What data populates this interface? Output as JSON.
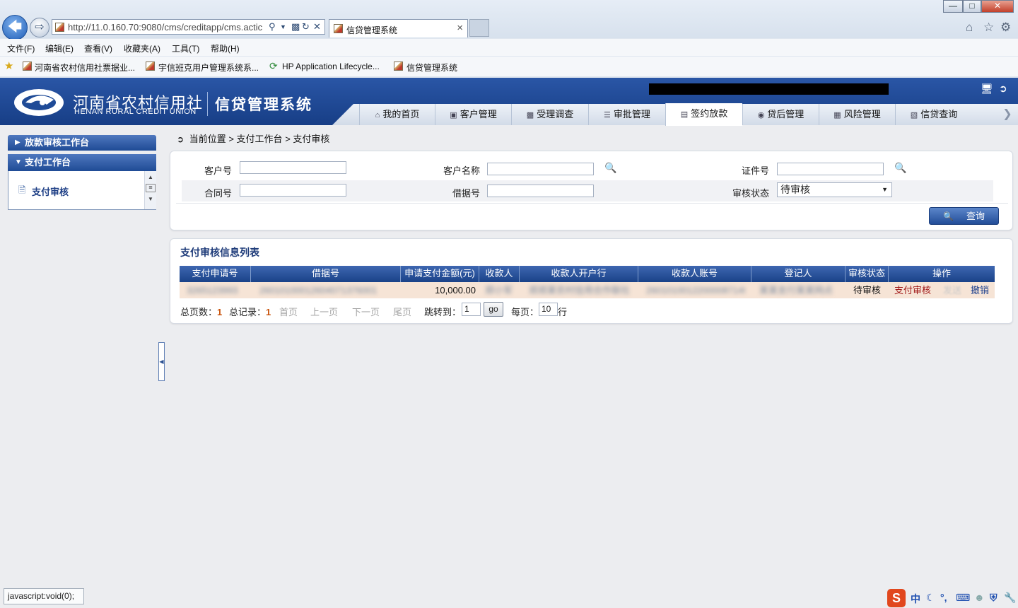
{
  "browser": {
    "url": "http://11.0.160.70:9080/cms/creditapp/cms.actic",
    "tab_title": "信贷管理系统",
    "menu": [
      "文件(F)",
      "编辑(E)",
      "查看(V)",
      "收藏夹(A)",
      "工具(T)",
      "帮助(H)"
    ],
    "favorites": [
      "河南省农村信用社票据业...",
      "宇信班克用户管理系统系...",
      "HP Application Lifecycle...",
      "信贷管理系统"
    ],
    "status_text": "javascript:void(0);"
  },
  "header": {
    "logo_cn": "河南省农村信用社",
    "logo_en": "HENAN RURAL CREDIT UNION",
    "system_title": "信贷管理系统",
    "nav_tabs": [
      "我的首页",
      "客户管理",
      "受理调查",
      "审批管理",
      "签约放款",
      "贷后管理",
      "风险管理",
      "信贷查询"
    ],
    "active_tab": 4
  },
  "sidebar": {
    "section1": "放款审核工作台",
    "section2": "支付工作台",
    "item": "支付审核"
  },
  "breadcrumb": {
    "prefix": "当前位置",
    "path1": "支付工作台",
    "path2": "支付审核"
  },
  "search": {
    "customer_no_label": "客户号",
    "customer_name_label": "客户名称",
    "id_no_label": "证件号",
    "contract_no_label": "合同号",
    "loan_no_label": "借据号",
    "status_label": "审核状态",
    "status_value": "待审核",
    "query_button": "查询"
  },
  "list": {
    "title": "支付审核信息列表",
    "columns": [
      "支付申请号",
      "借据号",
      "申请支付金额(元)",
      "收款人",
      "收款人开户行",
      "收款人账号",
      "登记人",
      "审核状态",
      "操作"
    ],
    "rows": [
      {
        "payment_no": "3265123993",
        "loan_no": "26010100012604071376001",
        "amount": "10,000.00",
        "payee": "郑小军",
        "payee_bank": "郑郑某农村信用合作联社",
        "payee_account": "26010100122000087140",
        "registrar": "某某支行某某网点",
        "status": "待审核",
        "action_review": "支付审核",
        "action_send": "发送",
        "action_revoke": "撤销"
      }
    ]
  },
  "pager": {
    "total_pages_label": "总页数：",
    "total_pages": "1",
    "total_records_label": "总记录：",
    "total_records": "1",
    "first": "首页",
    "prev": "上一页",
    "next": "下一页",
    "last": "尾页",
    "jump_label": "跳转到：",
    "jump_value": "1",
    "go": "go",
    "per_page_label": "每页：",
    "per_page": "10",
    "per_page_unit": "行"
  }
}
